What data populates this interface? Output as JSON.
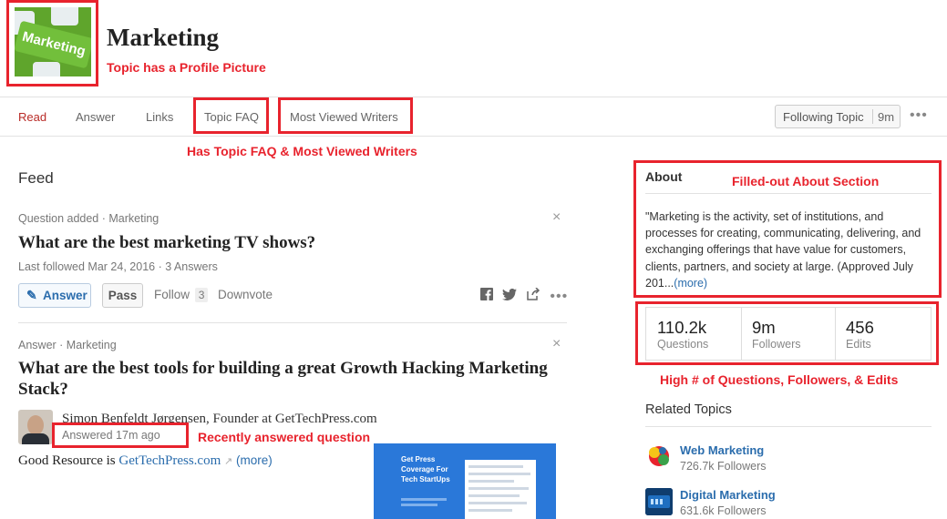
{
  "topic": {
    "title": "Marketing",
    "picture_text": "Marketing"
  },
  "annotations": {
    "profile_pic": "Topic has a Profile Picture",
    "faq_writers": "Has Topic FAQ & Most Viewed Writers",
    "about": "Filled-out About Section",
    "stats": "High # of Questions, Followers, & Edits",
    "recent": "Recently answered question"
  },
  "nav": {
    "tabs": [
      "Read",
      "Answer",
      "Links",
      "Topic FAQ",
      "Most Viewed Writers"
    ],
    "follow_label": "Following Topic",
    "follow_count": "9m",
    "more": "•••"
  },
  "feed": {
    "heading": "Feed",
    "items": [
      {
        "kind": "Question added · Marketing",
        "title": "What are the best marketing TV shows?",
        "meta": "Last followed Mar 24, 2016 · 3 Answers",
        "answer_label": "Answer",
        "pass_label": "Pass",
        "follow_label": "Follow",
        "follow_count": "3",
        "downvote_label": "Downvote",
        "close": "×"
      },
      {
        "kind": "Answer · Marketing",
        "title": "What are the best tools for building a great Growth Hacking Marketing Stack?",
        "author": "Simon Benfeldt Jørgensen, Founder at GetTechPress.com",
        "answered": "Answered 17m ago",
        "body_prefix": "Good Resource is ",
        "body_link": "GetTechPress.com",
        "more": "(more)",
        "close": "×",
        "thumb_text": "Get Press Coverage For Tech StartUps"
      }
    ]
  },
  "sidebar": {
    "about_heading": "About",
    "about_text": "\"Marketing is the activity, set of institutions, and processes for  creating, communicating, delivering, and exchanging offerings that have  value for customers, clients, partners, and society at large. (Approved  July 201...",
    "about_more": "(more)",
    "stats": [
      {
        "value": "110.2k",
        "label": "Questions"
      },
      {
        "value": "9m",
        "label": "Followers"
      },
      {
        "value": "456",
        "label": "Edits"
      }
    ],
    "related_heading": "Related Topics",
    "related": [
      {
        "name": "Web Marketing",
        "followers": "726.7k Followers"
      },
      {
        "name": "Digital Marketing",
        "followers": "631.6k Followers"
      }
    ]
  },
  "colors": {
    "annotation_red": "#e8232d",
    "link_blue": "#2b6dad",
    "active_tab": "#b92b27"
  }
}
